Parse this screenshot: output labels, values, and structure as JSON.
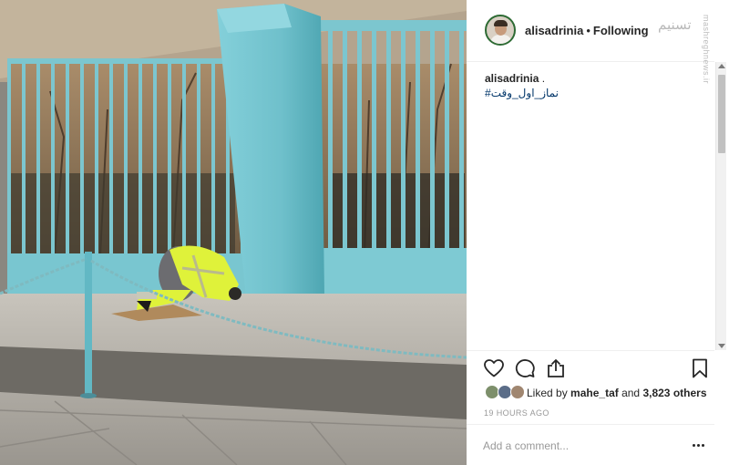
{
  "post": {
    "username": "alisadrinia",
    "follow_state": "Following",
    "separator": "•",
    "caption_user": "alisadrinia",
    "caption_text": ".",
    "hashtag": "#نماز_اول_وقت",
    "likes_prefix": "Liked by",
    "liked_by_user": "mahe_taf",
    "likes_joiner": "and",
    "likes_count": "3,823 others",
    "timestamp": "19 HOURS AGO"
  },
  "watermark": {
    "logo_text": "تسنیم",
    "site_text": "mashreghnews.ir"
  },
  "comment": {
    "placeholder": "Add a comment..."
  },
  "icons": {
    "like": "heart-icon",
    "comment": "comment-bubble-icon",
    "share": "share-icon",
    "save": "bookmark-icon",
    "more": "ellipsis-icon"
  },
  "colors": {
    "text": "#262626",
    "hashtag": "#003569",
    "muted": "#999999",
    "vest": "#dff23a",
    "wall": "#76c7d1"
  }
}
